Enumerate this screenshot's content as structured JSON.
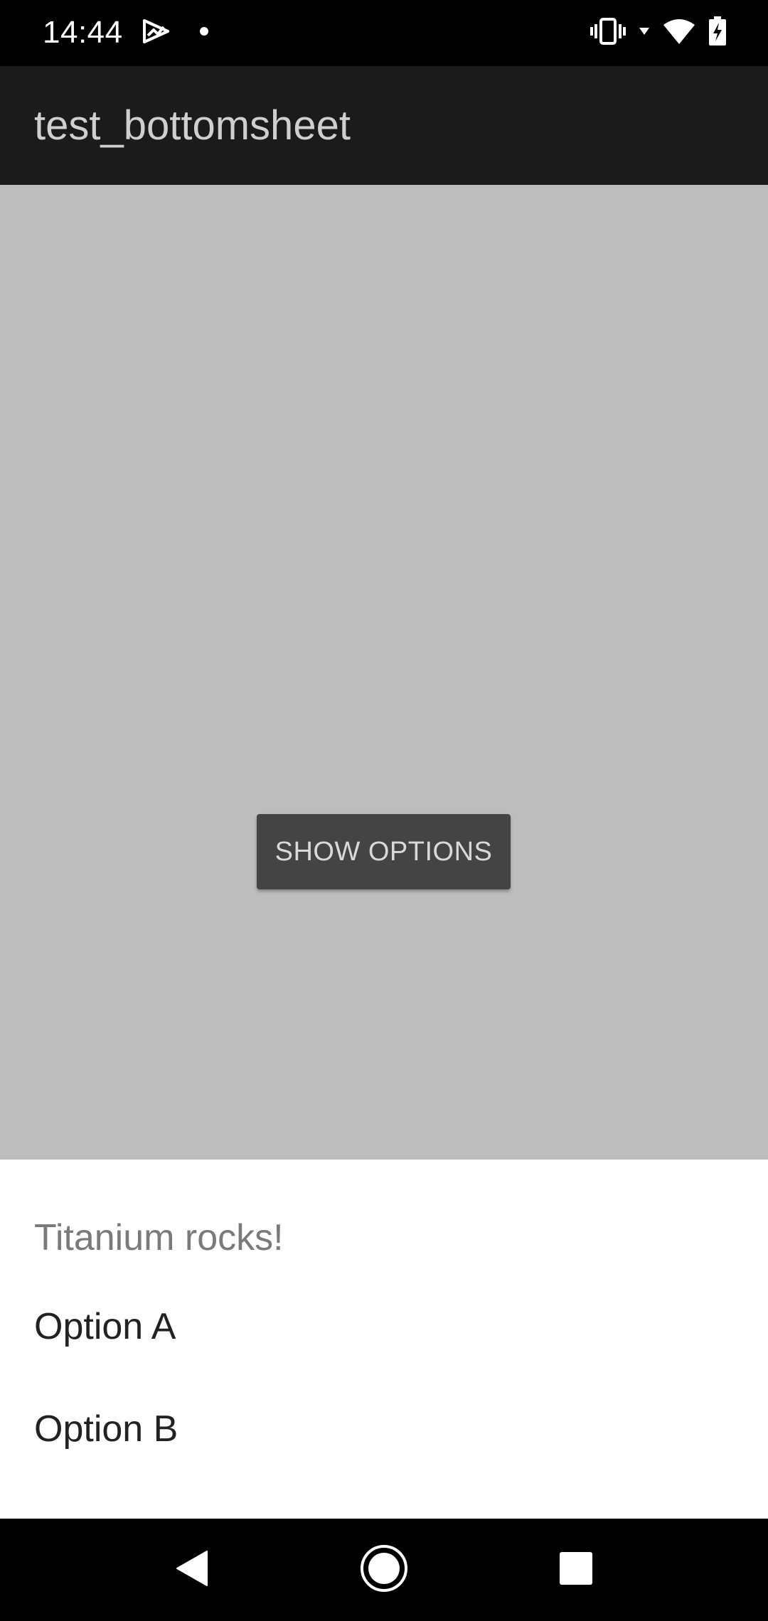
{
  "status_bar": {
    "time": "14:44",
    "icons": [
      "play-store-icon",
      "notification-dot-icon",
      "vibrate-icon",
      "wifi-icon",
      "battery-charging-icon"
    ]
  },
  "app_bar": {
    "title": "test_bottomsheet"
  },
  "content": {
    "button_label": "SHOW OPTIONS"
  },
  "bottom_sheet": {
    "title": "Titanium rocks!",
    "options": [
      {
        "label": "Option A"
      },
      {
        "label": "Option B"
      }
    ]
  },
  "nav_bar": {
    "buttons": [
      "back-icon",
      "home-icon",
      "recents-icon"
    ]
  },
  "colors": {
    "status_bar": "#000000",
    "app_bar": "#1b1b1b",
    "content_background": "#bdbdbd",
    "button": "#444444",
    "sheet": "#ffffff"
  }
}
